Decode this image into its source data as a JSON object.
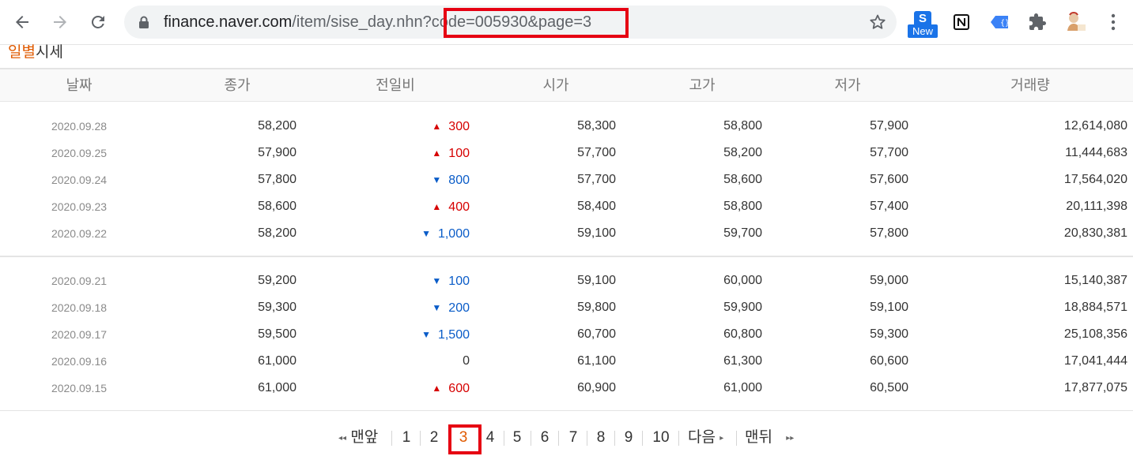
{
  "browser": {
    "url_host": "finance.naver.com",
    "url_path": "/item/sise_day.nhn?",
    "url_query": "code=005930&page=3",
    "extension_badge": "New",
    "extension_s_label": "S",
    "icons": {
      "back": "arrow-left-icon",
      "forward": "arrow-right-icon",
      "reload": "reload-icon",
      "lock": "lock-icon",
      "bookmark": "star-icon",
      "notion": "notion-icon",
      "extension2": "code-extension-icon",
      "extensions": "puzzle-icon",
      "profile": "avatar-icon",
      "menu": "kebab-menu-icon"
    },
    "highlight_color": "#e60012"
  },
  "page": {
    "title_accent": "일별",
    "title_rest": "시세",
    "accent_color": "#e05a00"
  },
  "table": {
    "headers": [
      "날짜",
      "종가",
      "전일비",
      "시가",
      "고가",
      "저가",
      "거래량"
    ],
    "up_color": "#d60000",
    "down_color": "#0a5cc8",
    "rows": [
      {
        "date": "2020.09.28",
        "close": "58,200",
        "dir": "up",
        "diff": "300",
        "open": "58,300",
        "high": "58,800",
        "low": "57,900",
        "volume": "12,614,080"
      },
      {
        "date": "2020.09.25",
        "close": "57,900",
        "dir": "up",
        "diff": "100",
        "open": "57,700",
        "high": "58,200",
        "low": "57,700",
        "volume": "11,444,683"
      },
      {
        "date": "2020.09.24",
        "close": "57,800",
        "dir": "down",
        "diff": "800",
        "open": "57,700",
        "high": "58,600",
        "low": "57,600",
        "volume": "17,564,020"
      },
      {
        "date": "2020.09.23",
        "close": "58,600",
        "dir": "up",
        "diff": "400",
        "open": "58,400",
        "high": "58,800",
        "low": "57,400",
        "volume": "20,111,398"
      },
      {
        "date": "2020.09.22",
        "close": "58,200",
        "dir": "down",
        "diff": "1,000",
        "open": "59,100",
        "high": "59,700",
        "low": "57,800",
        "volume": "20,830,381"
      },
      {
        "date": "2020.09.21",
        "close": "59,200",
        "dir": "down",
        "diff": "100",
        "open": "59,100",
        "high": "60,000",
        "low": "59,000",
        "volume": "15,140,387"
      },
      {
        "date": "2020.09.18",
        "close": "59,300",
        "dir": "down",
        "diff": "200",
        "open": "59,800",
        "high": "59,900",
        "low": "59,100",
        "volume": "18,884,571"
      },
      {
        "date": "2020.09.17",
        "close": "59,500",
        "dir": "down",
        "diff": "1,500",
        "open": "60,700",
        "high": "60,800",
        "low": "59,300",
        "volume": "25,108,356"
      },
      {
        "date": "2020.09.16",
        "close": "61,000",
        "dir": "flat",
        "diff": "0",
        "open": "61,100",
        "high": "61,300",
        "low": "60,600",
        "volume": "17,041,444"
      },
      {
        "date": "2020.09.15",
        "close": "61,000",
        "dir": "up",
        "diff": "600",
        "open": "60,900",
        "high": "61,000",
        "low": "60,500",
        "volume": "17,877,075"
      }
    ]
  },
  "pagination": {
    "first_label": "맨앞",
    "pages": [
      "1",
      "2",
      "3",
      "4",
      "5",
      "6",
      "7",
      "8",
      "9",
      "10"
    ],
    "current": "3",
    "next_label": "다음",
    "last_label": "맨뒤"
  }
}
